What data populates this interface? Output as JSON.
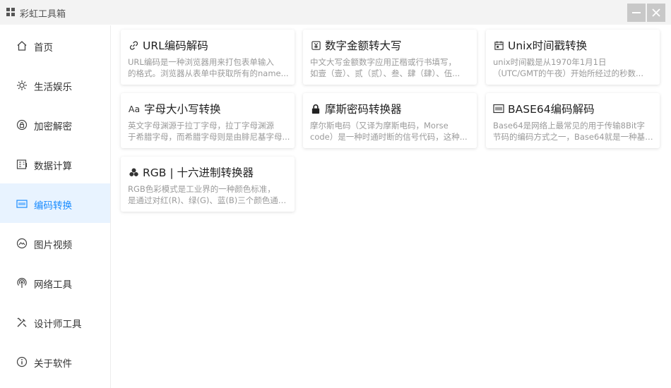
{
  "window": {
    "title": "彩虹工具箱"
  },
  "sidebar": {
    "items": [
      {
        "label": "首页",
        "icon": "home-icon"
      },
      {
        "label": "生活娱乐",
        "icon": "sun-icon"
      },
      {
        "label": "加密解密",
        "icon": "lock-circle-icon"
      },
      {
        "label": "数据计算",
        "icon": "calculator-icon"
      },
      {
        "label": "编码转换",
        "icon": "code-icon",
        "active": true
      },
      {
        "label": "图片视频",
        "icon": "image-icon"
      },
      {
        "label": "网络工具",
        "icon": "network-icon"
      },
      {
        "label": "设计师工具",
        "icon": "design-tools-icon"
      },
      {
        "label": "关于软件",
        "icon": "info-icon"
      }
    ]
  },
  "cards": [
    {
      "title": "URL编码解码",
      "icon": "link-icon",
      "desc1": "URL编码是一种浏览器用来打包表单输入",
      "desc2": "的格式。浏览器从表单中获取所有的name..."
    },
    {
      "title": "数字金额转大写",
      "icon": "money-icon",
      "desc1": "中文大写金额数字应用正楷或行书填写，",
      "desc2": "如壹（壹）、贰（贰）、叁、肆（肆）、伍..."
    },
    {
      "title": "Unix时间戳转换",
      "icon": "calendar-icon",
      "desc1": "unix时间戳是从1970年1月1日",
      "desc2": "（UTC/GMT的午夜）开始所经过的秒数..."
    },
    {
      "title": "字母大小写转换",
      "icon": "letter-case-icon",
      "icon_text": "Aa",
      "desc1": "英文字母渊源于拉丁字母，拉丁字母渊源",
      "desc2": "于希腊字母，而希腊字母则是由腓尼基字母..."
    },
    {
      "title": "摩斯密码转换器",
      "icon": "padlock-icon",
      "desc1": "摩尔斯电码（又译为摩斯电码，Morse",
      "desc2": "code）是一种时通时断的信号代码，这种..."
    },
    {
      "title": "BASE64编码解码",
      "icon": "base64-icon",
      "desc1": "Base64是网络上最常见的用于传输8Bit字",
      "desc2": "节码的编码方式之一，Base64就是一种基于..."
    },
    {
      "title": "RGB | 十六进制转换器",
      "icon": "rgb-icon",
      "desc1": "RGB色彩模式是工业界的一种颜色标准，",
      "desc2": "是通过对红(R)、绿(G)、蓝(B)三个颜色通道..."
    }
  ],
  "colors": {
    "accent": "#1a8cff",
    "active_bg": "#e8f3ff"
  }
}
